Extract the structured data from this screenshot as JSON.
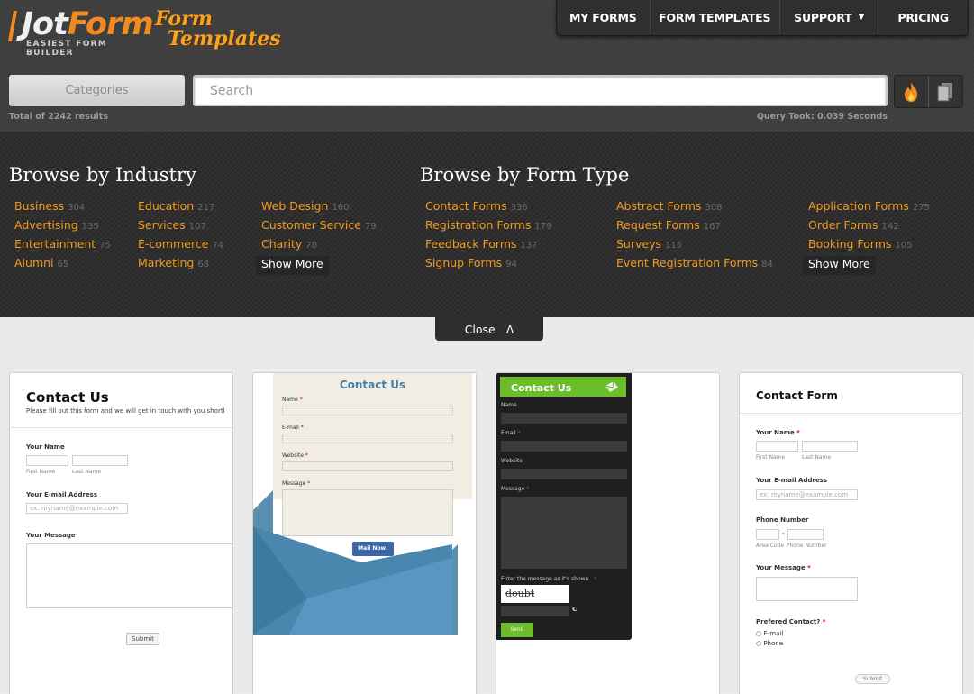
{
  "brand": {
    "name_prefix": "Jot",
    "name_suffix": "Form",
    "tagline": "EASIEST FORM BUILDER",
    "sub_logo_line1": "Form",
    "sub_logo_line2": "Templates",
    "accent": "#f28b1f"
  },
  "nav": {
    "items": [
      {
        "label": "MY FORMS"
      },
      {
        "label": "FORM TEMPLATES"
      },
      {
        "label": "SUPPORT",
        "caret": "▼"
      },
      {
        "label": "PRICING"
      }
    ]
  },
  "search": {
    "categories_label": "Categories",
    "placeholder": "Search",
    "total_prefix": "Total of ",
    "total_count": "2242",
    "total_suffix": " results",
    "query_time": "Query Took: 0.039 Seconds",
    "tool_icons": [
      "fire-icon",
      "pages-icon"
    ]
  },
  "browse": {
    "industry_title": "Browse by Industry",
    "form_type_title": "Browse by Form Type",
    "industry_columns": [
      [
        {
          "label": "Business",
          "count": "304"
        },
        {
          "label": "Advertising",
          "count": "135"
        },
        {
          "label": "Entertainment",
          "count": "75"
        },
        {
          "label": "Alumni",
          "count": "65"
        }
      ],
      [
        {
          "label": "Education",
          "count": "217"
        },
        {
          "label": "Services",
          "count": "107"
        },
        {
          "label": "E-commerce",
          "count": "74"
        },
        {
          "label": "Marketing",
          "count": "68"
        }
      ],
      [
        {
          "label": "Web Design",
          "count": "160"
        },
        {
          "label": "Customer Service",
          "count": "79"
        },
        {
          "label": "Charity",
          "count": "70"
        }
      ]
    ],
    "form_type_columns": [
      [
        {
          "label": "Contact Forms",
          "count": "336"
        },
        {
          "label": "Registration Forms",
          "count": "179"
        },
        {
          "label": "Feedback Forms",
          "count": "137"
        },
        {
          "label": "Signup Forms",
          "count": "94"
        }
      ],
      [
        {
          "label": "Abstract Forms",
          "count": "308"
        },
        {
          "label": "Request Forms",
          "count": "167"
        },
        {
          "label": "Surveys",
          "count": "115"
        },
        {
          "label": "Event Registration Forms",
          "count": "84"
        }
      ],
      [
        {
          "label": "Application Forms",
          "count": "275"
        },
        {
          "label": "Order Forms",
          "count": "142"
        },
        {
          "label": "Booking Forms",
          "count": "105"
        }
      ]
    ],
    "show_more_label": "Show More",
    "close_label": "Close",
    "close_icon": "Δ"
  },
  "cards": [
    {
      "title": "Contact Us",
      "subtitle": "Please fill out this form and we will get in touch with you shortl",
      "name_label": "Your Name",
      "first_label": "First Name",
      "last_label": "Last Name",
      "email_label": "Your E-mail Address",
      "email_placeholder": "ex: myname@example.com",
      "message_label": "Your Message",
      "submit_label": "Submit"
    },
    {
      "title": "Contact Us",
      "name_label": "Name",
      "email_label": "E-mail",
      "website_label": "Website",
      "message_label": "Message",
      "required": "*",
      "submit_label": "Mail Now!"
    },
    {
      "title": "Contact Us",
      "name_label": "Name",
      "email_label": "Email",
      "website_label": "Website",
      "message_label": "Message",
      "captcha_label": "Enter the message as it's shown",
      "captcha_text": "doubt",
      "refresh_glyph": "c",
      "send_label": "Send",
      "accent": "#6bbd2a"
    },
    {
      "title": "Contact Form",
      "name_label": "Your Name",
      "first_label": "First Name",
      "last_label": "Last Name",
      "email_label": "Your E-mail Address",
      "email_placeholder": "ex: myname@example.com",
      "phone_label": "Phone Number",
      "area_label": "Area Code",
      "phone_sub_label": "Phone Number",
      "dash": "-",
      "message_label": "Your Message",
      "contact_label": "Prefered Contact?",
      "options": [
        "E-mail",
        "Phone"
      ],
      "required": "*",
      "submit_label": "Submit"
    }
  ]
}
